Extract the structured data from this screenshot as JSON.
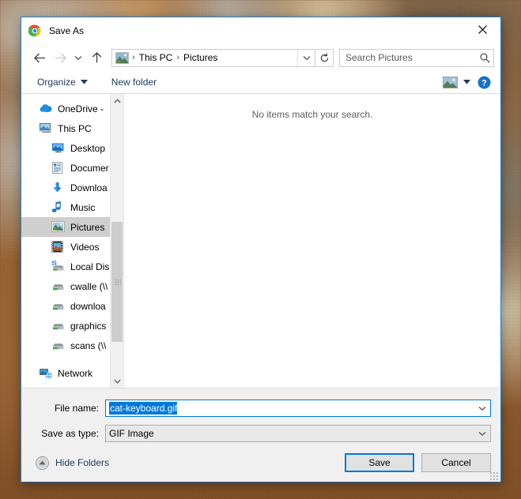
{
  "window": {
    "title": "Save As",
    "app_icon": "chrome-logo-icon",
    "close_label": "✕",
    "accent_color": "#1d7fd4"
  },
  "nav": {
    "back_label": "←",
    "forward_label": "→",
    "recent_label": "⌄",
    "up_label": "↑",
    "breadcrumb": [
      "This PC",
      "Pictures"
    ],
    "breadcrumb_icon": "pictures-folder-icon",
    "separator": "›",
    "dropdown_label": "⌄",
    "refresh_label": "↻"
  },
  "search": {
    "placeholder": "Search Pictures",
    "value": "",
    "icon": "search-icon"
  },
  "toolbar": {
    "organize_label": "Organize",
    "organize_caret": "▼",
    "new_folder_label": "New folder",
    "view_icon": "view-thumbnails-icon",
    "view_caret": "▼",
    "help_label": "?"
  },
  "sidebar": {
    "scroll_up": "⌃",
    "scroll_down": "⌄",
    "items": [
      {
        "label": "OneDrive -",
        "icon": "onedrive-cloud-icon",
        "indent": false,
        "selected": false
      },
      {
        "label": "This PC",
        "icon": "this-pc-icon",
        "indent": false,
        "selected": false
      },
      {
        "label": "Desktop",
        "icon": "desktop-icon",
        "indent": true,
        "selected": false
      },
      {
        "label": "Documer",
        "icon": "documents-icon",
        "indent": true,
        "selected": false
      },
      {
        "label": "Downloa",
        "icon": "downloads-icon",
        "indent": true,
        "selected": false
      },
      {
        "label": "Music",
        "icon": "music-icon",
        "indent": true,
        "selected": false
      },
      {
        "label": "Pictures",
        "icon": "pictures-icon",
        "indent": true,
        "selected": true
      },
      {
        "label": "Videos",
        "icon": "videos-icon",
        "indent": true,
        "selected": false
      },
      {
        "label": "Local Dis",
        "icon": "local-disk-icon",
        "indent": true,
        "selected": false
      },
      {
        "label": "cwalle (\\\\",
        "icon": "network-drive-icon",
        "indent": true,
        "selected": false
      },
      {
        "label": "downloa",
        "icon": "network-drive-icon",
        "indent": true,
        "selected": false
      },
      {
        "label": "graphics",
        "icon": "network-drive-icon",
        "indent": true,
        "selected": false
      },
      {
        "label": "scans (\\\\",
        "icon": "network-drive-icon",
        "indent": true,
        "selected": false
      },
      {
        "label": "Network",
        "icon": "network-icon",
        "indent": false,
        "selected": false
      }
    ]
  },
  "filelist": {
    "empty_message": "No items match your search."
  },
  "form": {
    "filename_label": "File name:",
    "filename_value": "cat-keyboard.gif",
    "filename_selected": true,
    "savetype_label": "Save as type:",
    "savetype_value": "GIF Image",
    "combo_caret": "⌄"
  },
  "footer": {
    "hide_folders_label": "Hide Folders",
    "hide_folders_icon": "collapse-up-icon",
    "save_label": "Save",
    "cancel_label": "Cancel",
    "save_is_default": true
  }
}
